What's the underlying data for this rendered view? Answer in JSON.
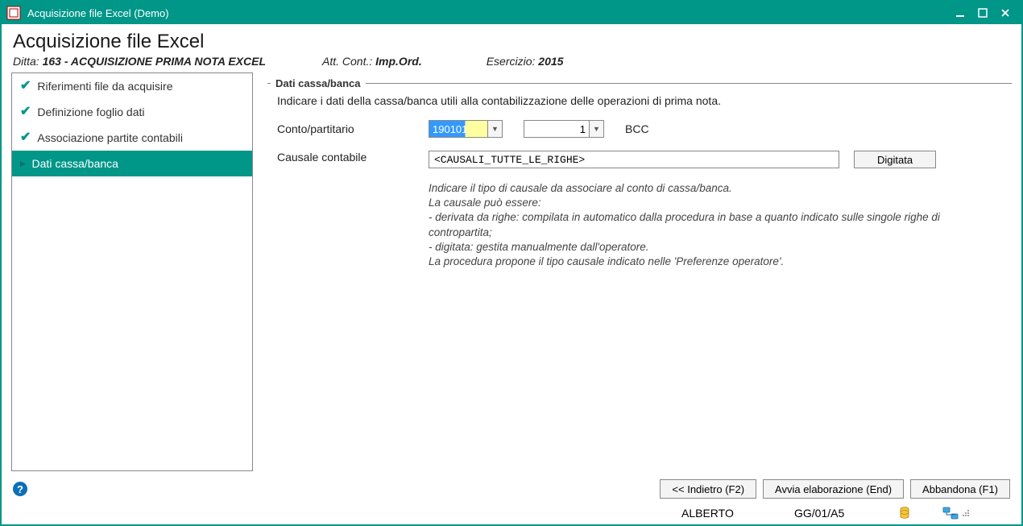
{
  "window": {
    "title": "Acquisizione file Excel  (Demo)"
  },
  "header": {
    "page_title": "Acquisizione file Excel",
    "ditta_label": "Ditta:",
    "ditta_value": "163 - ACQUISIZIONE PRIMA NOTA EXCEL",
    "att_label": "Att. Cont.:",
    "att_value": "Imp.Ord.",
    "esercizio_label": "Esercizio:",
    "esercizio_value": "2015"
  },
  "sidebar": {
    "items": [
      {
        "label": "Riferimenti file da acquisire",
        "done": true
      },
      {
        "label": "Definizione foglio dati",
        "done": true
      },
      {
        "label": "Associazione partite contabili",
        "done": true
      },
      {
        "label": "Dati cassa/banca",
        "active": true
      }
    ]
  },
  "main": {
    "legend": "Dati cassa/banca",
    "intro": "Indicare i dati della cassa/banca utili alla contabilizzazione delle operazioni di prima nota.",
    "conto_label": "Conto/partitario",
    "conto_value": "190101",
    "partitario_value": "1",
    "bank_name": "BCC",
    "causale_label": "Causale contabile",
    "causale_value": "<CAUSALI_TUTTE_LE_RIGHE>",
    "digitata_btn": "Digitata",
    "help_l1": "Indicare il tipo di causale da associare al conto di cassa/banca.",
    "help_l2": "La causale può essere:",
    "help_l3": "- derivata da righe: compilata in automatico dalla procedura in base a quanto indicato sulle singole righe di contropartita;",
    "help_l4": "- digitata: gestita manualmente dall'operatore.",
    "help_l5": "La procedura propone il tipo causale indicato nelle 'Preferenze operatore'."
  },
  "footer": {
    "back_btn": "<< Indietro (F2)",
    "start_btn": "Avvia elaborazione (End)",
    "abandon_btn": "Abbandona (F1)",
    "user": "ALBERTO",
    "code": "GG/01/A5"
  }
}
